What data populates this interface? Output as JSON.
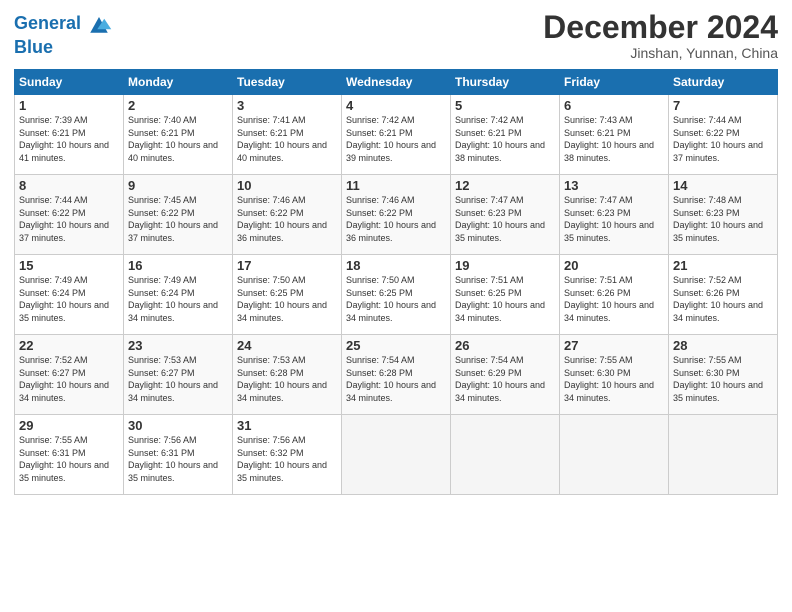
{
  "header": {
    "logo_line1": "General",
    "logo_line2": "Blue",
    "month": "December 2024",
    "location": "Jinshan, Yunnan, China"
  },
  "days_of_week": [
    "Sunday",
    "Monday",
    "Tuesday",
    "Wednesday",
    "Thursday",
    "Friday",
    "Saturday"
  ],
  "weeks": [
    [
      {
        "num": "1",
        "rise": "7:39 AM",
        "set": "6:21 PM",
        "daylight": "10 hours and 41 minutes."
      },
      {
        "num": "2",
        "rise": "7:40 AM",
        "set": "6:21 PM",
        "daylight": "10 hours and 40 minutes."
      },
      {
        "num": "3",
        "rise": "7:41 AM",
        "set": "6:21 PM",
        "daylight": "10 hours and 40 minutes."
      },
      {
        "num": "4",
        "rise": "7:42 AM",
        "set": "6:21 PM",
        "daylight": "10 hours and 39 minutes."
      },
      {
        "num": "5",
        "rise": "7:42 AM",
        "set": "6:21 PM",
        "daylight": "10 hours and 38 minutes."
      },
      {
        "num": "6",
        "rise": "7:43 AM",
        "set": "6:21 PM",
        "daylight": "10 hours and 38 minutes."
      },
      {
        "num": "7",
        "rise": "7:44 AM",
        "set": "6:22 PM",
        "daylight": "10 hours and 37 minutes."
      }
    ],
    [
      {
        "num": "8",
        "rise": "7:44 AM",
        "set": "6:22 PM",
        "daylight": "10 hours and 37 minutes."
      },
      {
        "num": "9",
        "rise": "7:45 AM",
        "set": "6:22 PM",
        "daylight": "10 hours and 37 minutes."
      },
      {
        "num": "10",
        "rise": "7:46 AM",
        "set": "6:22 PM",
        "daylight": "10 hours and 36 minutes."
      },
      {
        "num": "11",
        "rise": "7:46 AM",
        "set": "6:22 PM",
        "daylight": "10 hours and 36 minutes."
      },
      {
        "num": "12",
        "rise": "7:47 AM",
        "set": "6:23 PM",
        "daylight": "10 hours and 35 minutes."
      },
      {
        "num": "13",
        "rise": "7:47 AM",
        "set": "6:23 PM",
        "daylight": "10 hours and 35 minutes."
      },
      {
        "num": "14",
        "rise": "7:48 AM",
        "set": "6:23 PM",
        "daylight": "10 hours and 35 minutes."
      }
    ],
    [
      {
        "num": "15",
        "rise": "7:49 AM",
        "set": "6:24 PM",
        "daylight": "10 hours and 35 minutes."
      },
      {
        "num": "16",
        "rise": "7:49 AM",
        "set": "6:24 PM",
        "daylight": "10 hours and 34 minutes."
      },
      {
        "num": "17",
        "rise": "7:50 AM",
        "set": "6:25 PM",
        "daylight": "10 hours and 34 minutes."
      },
      {
        "num": "18",
        "rise": "7:50 AM",
        "set": "6:25 PM",
        "daylight": "10 hours and 34 minutes."
      },
      {
        "num": "19",
        "rise": "7:51 AM",
        "set": "6:25 PM",
        "daylight": "10 hours and 34 minutes."
      },
      {
        "num": "20",
        "rise": "7:51 AM",
        "set": "6:26 PM",
        "daylight": "10 hours and 34 minutes."
      },
      {
        "num": "21",
        "rise": "7:52 AM",
        "set": "6:26 PM",
        "daylight": "10 hours and 34 minutes."
      }
    ],
    [
      {
        "num": "22",
        "rise": "7:52 AM",
        "set": "6:27 PM",
        "daylight": "10 hours and 34 minutes."
      },
      {
        "num": "23",
        "rise": "7:53 AM",
        "set": "6:27 PM",
        "daylight": "10 hours and 34 minutes."
      },
      {
        "num": "24",
        "rise": "7:53 AM",
        "set": "6:28 PM",
        "daylight": "10 hours and 34 minutes."
      },
      {
        "num": "25",
        "rise": "7:54 AM",
        "set": "6:28 PM",
        "daylight": "10 hours and 34 minutes."
      },
      {
        "num": "26",
        "rise": "7:54 AM",
        "set": "6:29 PM",
        "daylight": "10 hours and 34 minutes."
      },
      {
        "num": "27",
        "rise": "7:55 AM",
        "set": "6:30 PM",
        "daylight": "10 hours and 34 minutes."
      },
      {
        "num": "28",
        "rise": "7:55 AM",
        "set": "6:30 PM",
        "daylight": "10 hours and 35 minutes."
      }
    ],
    [
      {
        "num": "29",
        "rise": "7:55 AM",
        "set": "6:31 PM",
        "daylight": "10 hours and 35 minutes."
      },
      {
        "num": "30",
        "rise": "7:56 AM",
        "set": "6:31 PM",
        "daylight": "10 hours and 35 minutes."
      },
      {
        "num": "31",
        "rise": "7:56 AM",
        "set": "6:32 PM",
        "daylight": "10 hours and 35 minutes."
      },
      null,
      null,
      null,
      null
    ]
  ]
}
